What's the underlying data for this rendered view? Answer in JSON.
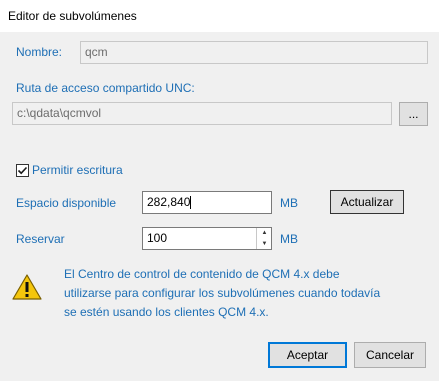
{
  "window": {
    "title": "Editor de subvolúmenes"
  },
  "name": {
    "label": "Nombre:",
    "value": "qcm"
  },
  "unc": {
    "label": "Ruta de acceso compartido UNC:",
    "value": "c:\\qdata\\qcmvol",
    "browse_label": "..."
  },
  "write": {
    "label": "Permitir escritura",
    "checked": true
  },
  "space": {
    "label": "Espacio disponible",
    "value": "282,840",
    "unit": "MB",
    "refresh_label": "Actualizar"
  },
  "reserve": {
    "label": "Reservar",
    "value": "100",
    "unit": "MB"
  },
  "warning": {
    "icon": "warning-icon",
    "lines": [
      "El Centro de control de contenido de QCM 4.x debe",
      "utilizarse para configurar los subvolúmenes cuando todavía",
      "se estén usando los clientes QCM 4.x."
    ]
  },
  "buttons": {
    "ok_label": "Aceptar",
    "cancel_label": "Cancelar"
  }
}
